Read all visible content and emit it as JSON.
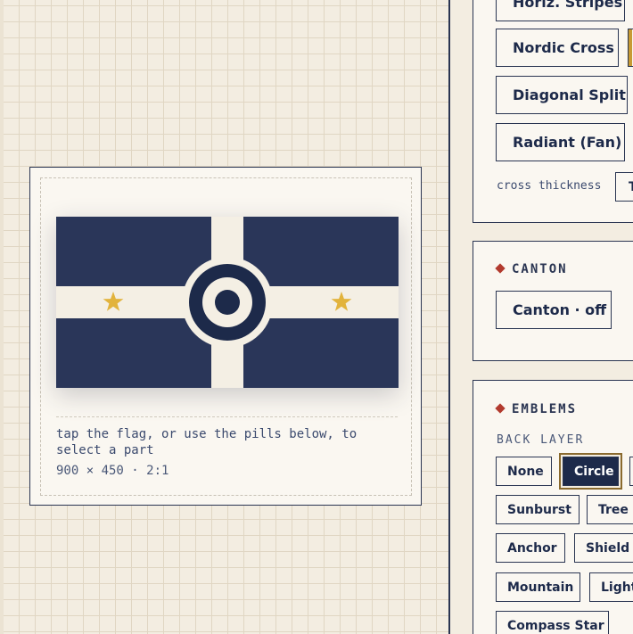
{
  "preview": {
    "hint": "tap the flag, or use the pills below, to select a part",
    "dimensions": "900 × 450 · 2:1",
    "flag": {
      "field_color": "#2a3659",
      "cross_color": "#f4efe4",
      "emblem_color": "#1d2a4a",
      "star_color": "#e2b33c"
    }
  },
  "layout_panel": {
    "options": [
      "Horiz. Stripes",
      "Nordic Cross",
      "Diagonal Split",
      "Radiant (Fan)"
    ],
    "cross_thickness_label": "cross thickness",
    "cross_thickness_value": "T"
  },
  "canton": {
    "title": "CANTON",
    "toggle_label": "Canton · off"
  },
  "emblems": {
    "title": "EMBLEMS",
    "back_layer_label": "BACK LAYER",
    "options": [
      "None",
      "Circle",
      "Sunburst",
      "Tree",
      "Anchor",
      "Shield",
      "Mountain",
      "Light",
      "Compass Star"
    ],
    "selected": "Circle"
  }
}
